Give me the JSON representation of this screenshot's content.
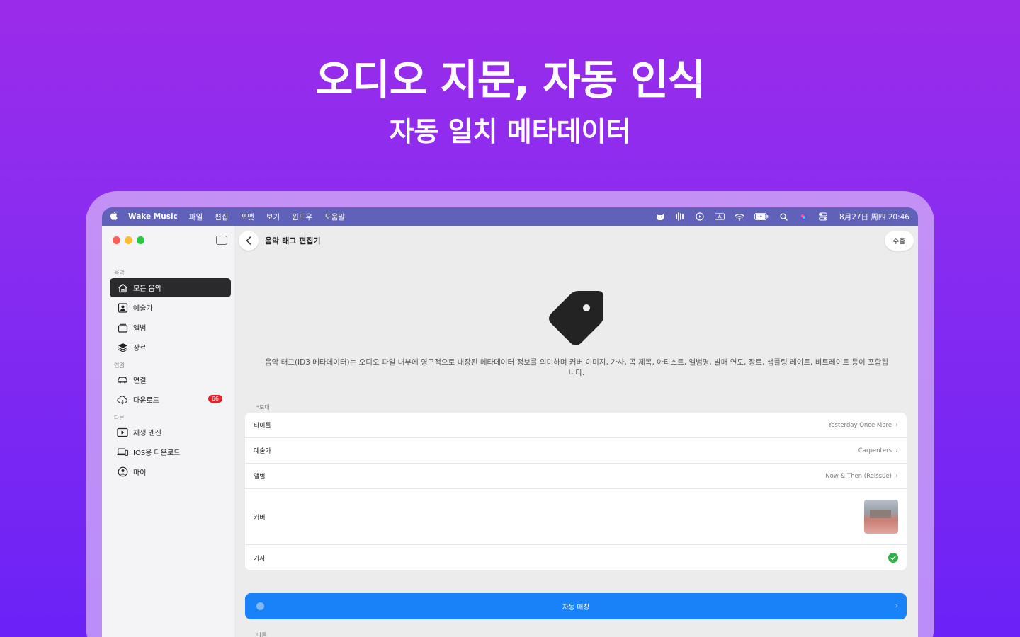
{
  "hero": {
    "headline": "오디오 지문, 자동 인식",
    "subheadline": "자동 일치 메타데이터"
  },
  "menubar": {
    "app_name": "Wake Music",
    "menus": [
      "파일",
      "편집",
      "포맷",
      "보기",
      "윈도우",
      "도움말"
    ],
    "clock": "8月27日 周四 20:46",
    "status_icons": [
      "cat-icon",
      "waveform-icon",
      "play-circle-icon",
      "input-a-icon",
      "wifi-icon",
      "battery-icon",
      "search-icon",
      "siri-icon",
      "control-center-icon"
    ]
  },
  "sidebar": {
    "section_music": "음악",
    "section_connect": "연결",
    "section_other": "다른",
    "items": [
      {
        "label": "모든 음악",
        "icon": "home-icon"
      },
      {
        "label": "예술가",
        "icon": "artist-icon"
      },
      {
        "label": "앨범",
        "icon": "album-icon"
      },
      {
        "label": "장르",
        "icon": "layers-icon"
      },
      {
        "label": "연결",
        "icon": "car-icon"
      },
      {
        "label": "다운로드",
        "icon": "cloud-download-icon",
        "badge": "66"
      },
      {
        "label": "재생 엔진",
        "icon": "play-square-icon"
      },
      {
        "label": "IOS용 다운로드",
        "icon": "devices-icon"
      },
      {
        "label": "마이",
        "icon": "person-icon"
      }
    ]
  },
  "main": {
    "title": "음악 태그 편집기",
    "export_label": "수출",
    "description": "음악 태그(ID3 메타데이터)는 오디오 파일 내부에 영구적으로 내장된 메타데이터 정보를 의미하며 커버 이미지, 가사, 곡 제목, 아티스트, 앨범명, 발매 연도, 장르, 샘플링 레이트, 비트레이트 등이 포함됩니다.",
    "group_label": "*토대",
    "rows": [
      {
        "label": "타이틀",
        "value": "Yesterday Once More"
      },
      {
        "label": "예술가",
        "value": "Carpenters"
      },
      {
        "label": "앨범",
        "value": "Now & Then (Reissue)"
      },
      {
        "label": "커버"
      },
      {
        "label": "가사"
      }
    ],
    "match_label": "자동 매칭",
    "other_label": "다른"
  },
  "colors": {
    "accent": "#1a82f8",
    "badge": "#e5222b",
    "check": "#2db24a",
    "menubar": "#5f62b8"
  }
}
